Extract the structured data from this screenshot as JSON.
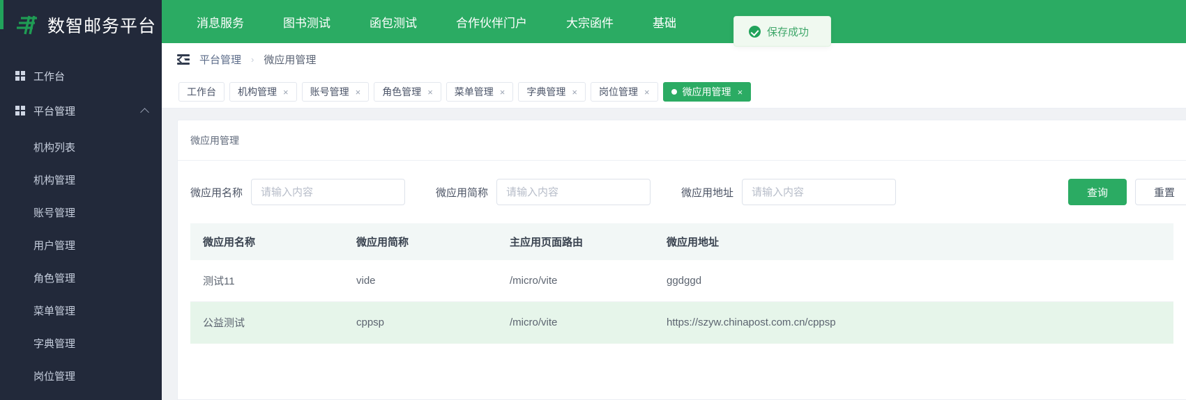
{
  "sidebar": {
    "brand": {
      "title": "数智邮务平台",
      "logo_icon": "post-logo-icon"
    },
    "groups": [
      {
        "label": "工作台",
        "icon": "grid-icon",
        "expanded": false
      },
      {
        "label": "平台管理",
        "icon": "grid-icon",
        "expanded": true,
        "chevron_icon": "chevron-up-icon"
      }
    ],
    "items": [
      {
        "label": "机构列表"
      },
      {
        "label": "机构管理"
      },
      {
        "label": "账号管理"
      },
      {
        "label": "用户管理"
      },
      {
        "label": "角色管理"
      },
      {
        "label": "菜单管理"
      },
      {
        "label": "字典管理"
      },
      {
        "label": "岗位管理"
      }
    ]
  },
  "topnav": {
    "items": [
      {
        "label": "消息服务"
      },
      {
        "label": "图书测试"
      },
      {
        "label": "函包测试"
      },
      {
        "label": "合作伙伴门户"
      },
      {
        "label": "大宗函件"
      },
      {
        "label": "基础"
      }
    ]
  },
  "toast": {
    "icon": "success-check-icon",
    "message": "保存成功",
    "accent_color": "#22a35b",
    "bg_color": "#f0f9f0"
  },
  "breadcrumb": {
    "collapse_icon": "menu-fold-icon",
    "items": [
      {
        "label": "平台管理"
      },
      {
        "label": "微应用管理"
      }
    ],
    "separator": "›"
  },
  "tabs": {
    "close_glyph": "×",
    "items": [
      {
        "label": "工作台",
        "closable": false,
        "active": false
      },
      {
        "label": "机构管理",
        "closable": true,
        "active": false
      },
      {
        "label": "账号管理",
        "closable": true,
        "active": false
      },
      {
        "label": "角色管理",
        "closable": true,
        "active": false
      },
      {
        "label": "菜单管理",
        "closable": true,
        "active": false
      },
      {
        "label": "字典管理",
        "closable": true,
        "active": false
      },
      {
        "label": "岗位管理",
        "closable": true,
        "active": false
      },
      {
        "label": "微应用管理",
        "closable": true,
        "active": true
      }
    ]
  },
  "card": {
    "title": "微应用管理"
  },
  "search": {
    "fields": [
      {
        "label": "微应用名称",
        "value": "",
        "placeholder": "请输入内容"
      },
      {
        "label": "微应用简称",
        "value": "",
        "placeholder": "请输入内容"
      },
      {
        "label": "微应用地址",
        "value": "",
        "placeholder": "请输入内容"
      }
    ],
    "buttons": [
      {
        "label": "查询",
        "style": "primary"
      },
      {
        "label": "重置",
        "style": "ghost"
      }
    ]
  },
  "table": {
    "columns": [
      "微应用名称",
      "微应用简称",
      "主应用页面路由",
      "微应用地址"
    ],
    "rows": [
      {
        "name": "测试11",
        "short_name": "vide",
        "route": "/micro/vite",
        "url": "ggdggd",
        "highlighted": false
      },
      {
        "name": "公益测试",
        "short_name": "cppsp",
        "route": "/micro/vite",
        "url": "https://szyw.chinapost.com.cn/cppsp",
        "highlighted": true
      }
    ]
  },
  "theme": {
    "brand_green": "#2bab63",
    "sidebar_bg": "#22293a",
    "page_bg": "#f0f2f5",
    "table_header_bg": "#f2f7f6",
    "row_highlight_bg": "#e6f5ea"
  }
}
